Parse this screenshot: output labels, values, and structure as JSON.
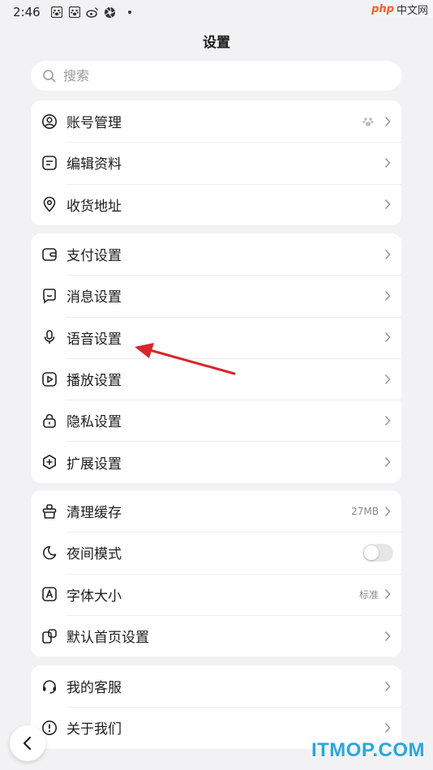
{
  "status_bar": {
    "time": "2:46",
    "icons": [
      "paw-icon",
      "paw-icon",
      "weibo-icon",
      "aperture-icon"
    ]
  },
  "watermark_top": {
    "php": "php",
    "text": "中文网"
  },
  "page": {
    "title": "设置"
  },
  "search": {
    "placeholder": "搜索",
    "value": ""
  },
  "groups": [
    {
      "items": [
        {
          "label": "账号管理",
          "icon": "account-icon",
          "extra": "paw-icon"
        },
        {
          "label": "编辑资料",
          "icon": "edit-profile-icon"
        },
        {
          "label": "收货地址",
          "icon": "location-icon"
        }
      ]
    },
    {
      "items": [
        {
          "label": "支付设置",
          "icon": "wallet-icon"
        },
        {
          "label": "消息设置",
          "icon": "message-icon"
        },
        {
          "label": "语音设置",
          "icon": "microphone-icon"
        },
        {
          "label": "播放设置",
          "icon": "play-icon"
        },
        {
          "label": "隐私设置",
          "icon": "lock-icon"
        },
        {
          "label": "扩展设置",
          "icon": "extension-icon"
        }
      ]
    },
    {
      "items": [
        {
          "label": "清理缓存",
          "icon": "broom-icon",
          "value": "27MB"
        },
        {
          "label": "夜间模式",
          "icon": "moon-icon",
          "toggle": false
        },
        {
          "label": "字体大小",
          "icon": "font-icon",
          "value": "标准"
        },
        {
          "label": "默认首页设置",
          "icon": "home-settings-icon"
        }
      ]
    },
    {
      "items": [
        {
          "label": "我的客服",
          "icon": "headset-icon"
        },
        {
          "label": "关于我们",
          "icon": "info-icon"
        }
      ]
    }
  ],
  "bottom_watermark": "ITMOP.COM",
  "colors": {
    "background": "#f2f2f4",
    "card": "#ffffff",
    "annotation_arrow": "#d9262a",
    "watermark": "#2aa7e0"
  }
}
